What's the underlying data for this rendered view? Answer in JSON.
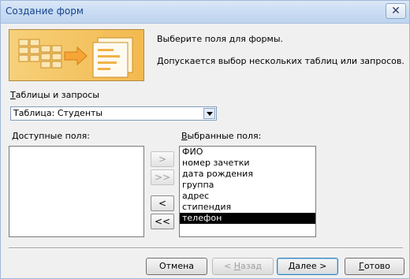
{
  "window": {
    "title": "Создание форм",
    "close_symbol": "✕"
  },
  "intro": {
    "line1": "Выберите поля для формы.",
    "line2": "Допускается выбор нескольких таблиц или запросов."
  },
  "tables_queries": {
    "label_accel": "Т",
    "label_rest": "аблицы и запросы",
    "selected_value": "Таблица: Студенты"
  },
  "available_fields": {
    "label_accel": "Д",
    "label_rest": "оступные поля:",
    "items": []
  },
  "selected_fields": {
    "label_accel": "В",
    "label_rest": "ыбранные поля:",
    "items": [
      "ФИО",
      "номер зачетки",
      "дата рождения",
      "группа",
      "адрес",
      "стипендия",
      "телефон"
    ],
    "selected_index": 6
  },
  "move_buttons": {
    "add_one": ">",
    "add_all": ">>",
    "remove_one": "<",
    "remove_all": "<<"
  },
  "footer": {
    "cancel": "Отмена",
    "back_prefix": "< ",
    "back_accel": "Н",
    "back_rest": "азад",
    "next_accel": "Д",
    "next_rest": "алее >",
    "finish_accel": "Г",
    "finish_rest": "отово"
  },
  "colors": {
    "title_text": "#15428b",
    "selection_bg": "#000000",
    "image_panel": "#f3b94e"
  },
  "icons": {
    "combo_dropdown": "chevron-down-icon",
    "close": "close-icon"
  }
}
